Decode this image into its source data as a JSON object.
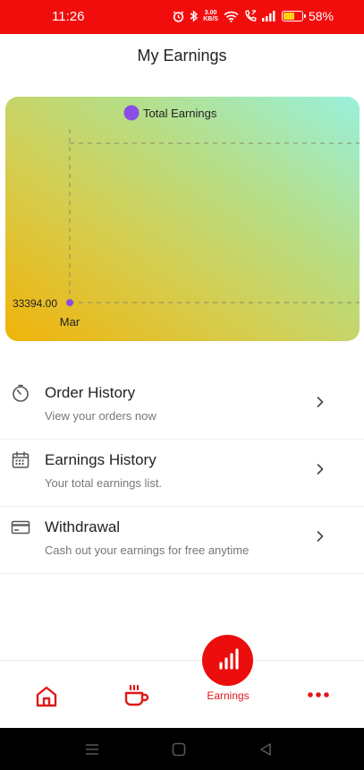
{
  "status_bar": {
    "time": "11:26",
    "net_speed": "3.00",
    "net_unit": "KB/S",
    "battery": "58%",
    "battery_level": 0.58
  },
  "header": {
    "title": "My Earnings"
  },
  "chart_data": {
    "type": "line",
    "legend": [
      "Total Earnings"
    ],
    "series": [
      {
        "name": "Total Earnings",
        "color": "#8a4ee6",
        "points": [
          {
            "x": "Mar",
            "y": 33394.0
          }
        ]
      }
    ],
    "categories": [
      "Mar"
    ],
    "y_tick_labels": [
      "33394.00"
    ],
    "grid": "dashed",
    "legend_placement": "top-center"
  },
  "menu": {
    "items": [
      {
        "icon": "timer-icon",
        "title": "Order History",
        "subtitle": "View your orders now"
      },
      {
        "icon": "calendar-icon",
        "title": "Earnings History",
        "subtitle": "Your total earnings list."
      },
      {
        "icon": "card-icon",
        "title": "Withdrawal",
        "subtitle": "Cash out your earnings for free anytime"
      }
    ]
  },
  "bottom_nav": {
    "items": [
      "home-icon",
      "coffee-icon",
      "earnings-icon",
      "more-icon"
    ],
    "active_label": "Earnings",
    "accent": "#ec0d0d"
  }
}
